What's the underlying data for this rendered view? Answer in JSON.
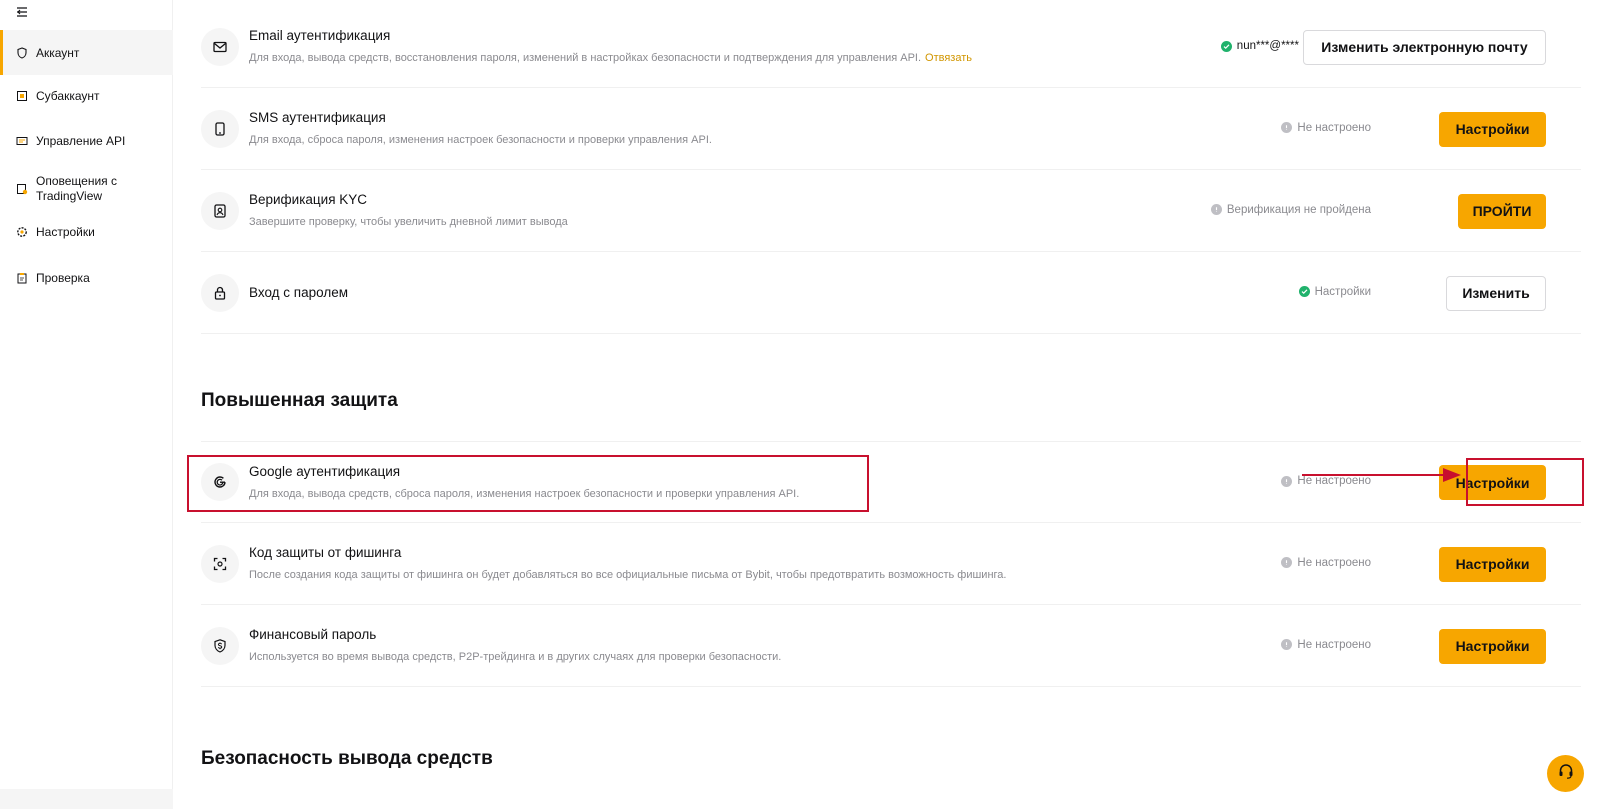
{
  "sidebar": {
    "items": [
      {
        "label": "Аккаунт",
        "icon": "shield-icon",
        "active": true
      },
      {
        "label": "Субаккаунт",
        "icon": "subaccount-icon",
        "active": false
      },
      {
        "label": "Управление API",
        "icon": "api-icon",
        "active": false
      },
      {
        "label": "Оповещения с",
        "label2": "TradingView",
        "icon": "alert-icon",
        "active": false
      },
      {
        "label": "Настройки",
        "icon": "gear-icon",
        "active": false
      },
      {
        "label": "Проверка",
        "icon": "clipboard-icon",
        "active": false
      }
    ]
  },
  "basic_rows": [
    {
      "title": "Email аутентификация",
      "desc": "Для входа, вывода средств, восстановления пароля, изменений в настройках безопасности и подтверждения для управления API.",
      "link": "Отвязать",
      "status": "nun***@****",
      "status_type": "green",
      "button": "Изменить электронную почту",
      "button_style": "outline",
      "icon": "email-icon"
    },
    {
      "title": "SMS аутентификация",
      "desc": "Для входа, сброса пароля, изменения настроек безопасности и проверки управления API.",
      "status": "Не настроено",
      "status_type": "gray",
      "button": "Настройки",
      "button_style": "primary",
      "icon": "phone-icon"
    },
    {
      "title": "Верификация KYC",
      "desc": "Завершите проверку, чтобы увеличить дневной лимит вывода",
      "status": "Верификация не пройдена",
      "status_type": "gray",
      "button": "ПРОЙТИ",
      "button_style": "primary",
      "icon": "id-card-icon"
    },
    {
      "title": "Вход с паролем",
      "status": "Настройки",
      "status_type": "green",
      "button": "Изменить",
      "button_style": "outline",
      "icon": "lock-icon"
    }
  ],
  "sections": {
    "advanced_title": "Повышенная защита",
    "withdrawal_title": "Безопасность вывода средств"
  },
  "advanced_rows": [
    {
      "title": "Google аутентификация",
      "desc": "Для входа, вывода средств, сброса пароля, изменения настроек безопасности и проверки управления API.",
      "status": "Не настроено",
      "status_type": "gray",
      "button": "Настройки",
      "button_style": "primary",
      "icon": "google-icon"
    },
    {
      "title": "Код защиты от фишинга",
      "desc": "После создания кода защиты от фишинга он будет добавляться во все официальные письма от Bybit, чтобы предотвратить возможность фишинга.",
      "status": "Не настроено",
      "status_type": "gray",
      "button": "Настройки",
      "button_style": "primary",
      "icon": "scan-icon"
    },
    {
      "title": "Финансовый пароль",
      "desc": "Используется во время вывода средств, P2P-трейдинга и в других случаях для проверки безопасности.",
      "status": "Не настроено",
      "status_type": "gray",
      "button": "Настройки",
      "button_style": "primary",
      "icon": "dollar-shield-icon"
    }
  ],
  "colors": {
    "accent": "#f7a600",
    "success": "#20b26c",
    "annotation": "#c8102e",
    "muted": "#8a8a8f"
  }
}
